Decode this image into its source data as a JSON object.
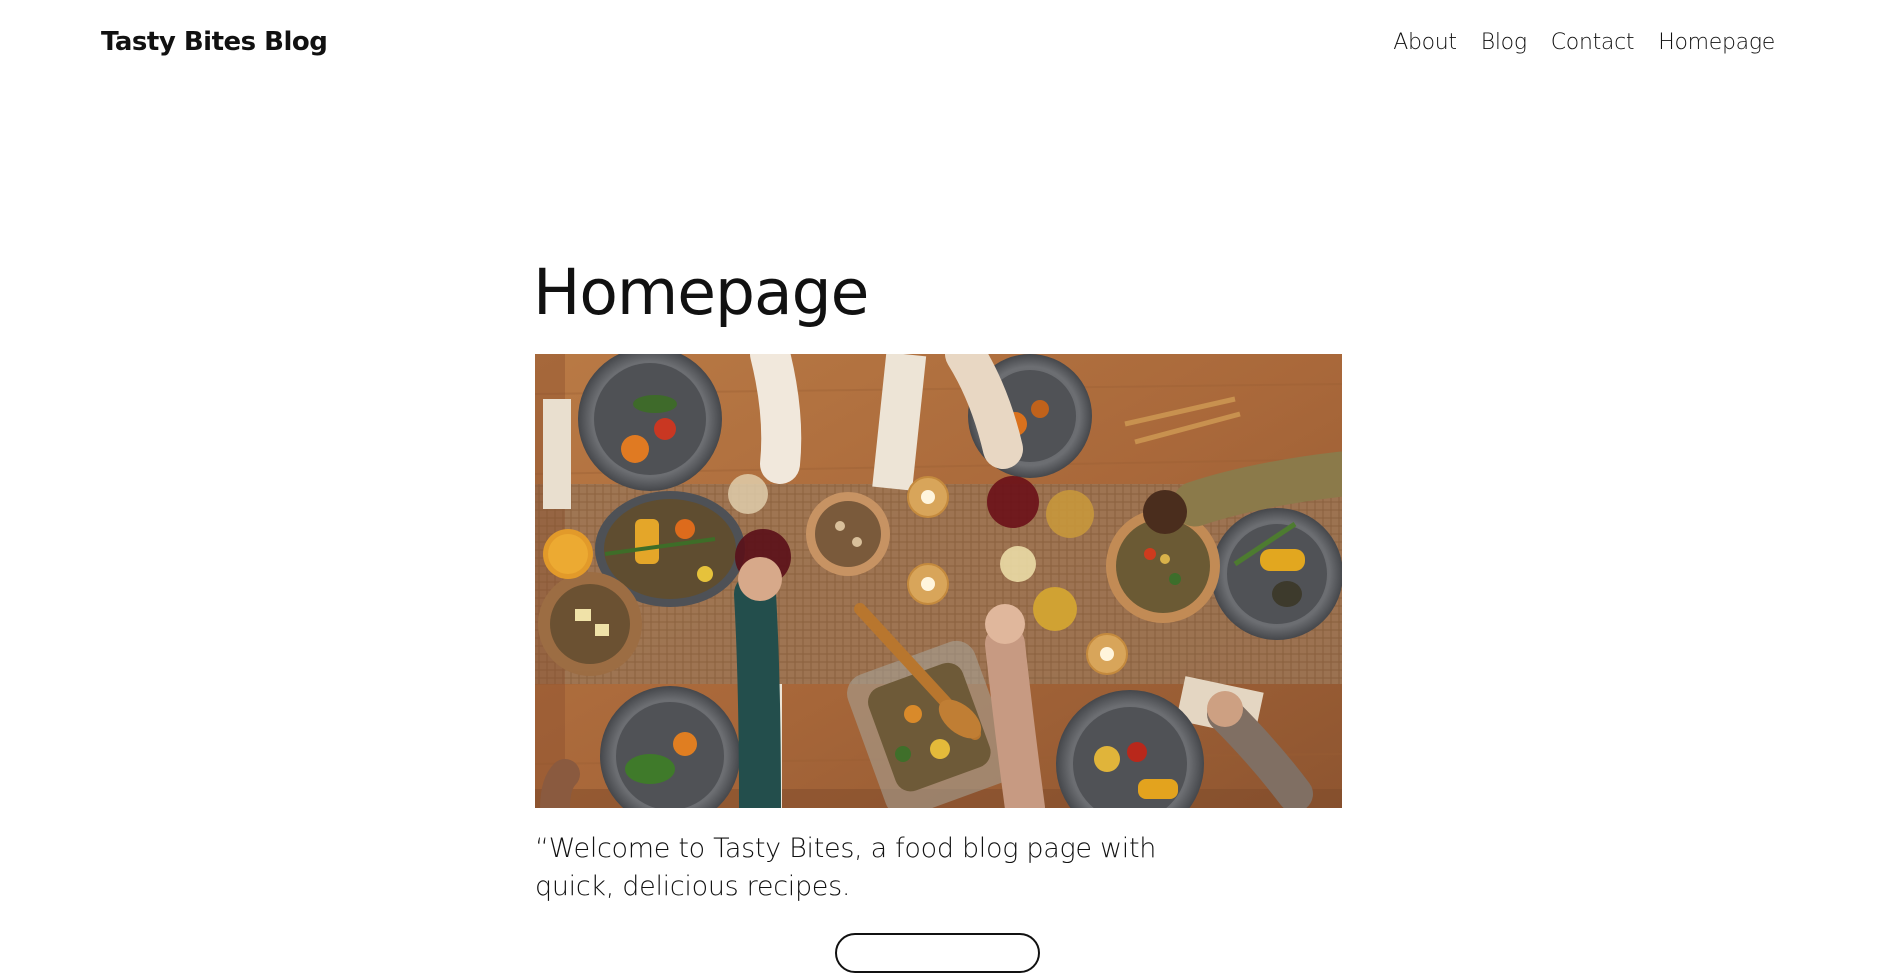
{
  "header": {
    "site_title": "Tasty Bites Blog",
    "nav": [
      {
        "label": "About"
      },
      {
        "label": "Blog"
      },
      {
        "label": "Contact"
      },
      {
        "label": "Homepage"
      }
    ]
  },
  "main": {
    "heading": "Homepage",
    "intro": "“Welcome to Tasty Bites, a food blog page with quick, delicious recipes."
  }
}
